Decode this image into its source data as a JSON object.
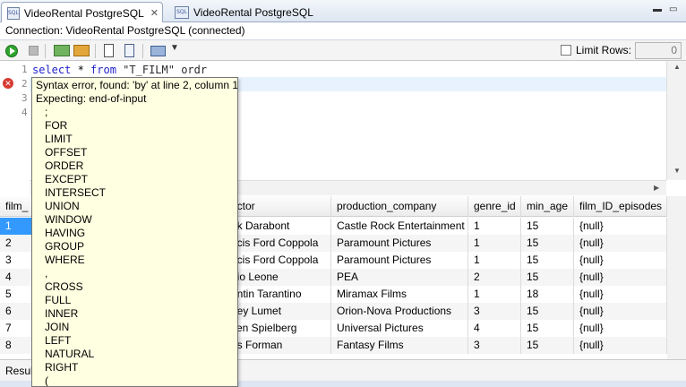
{
  "tabs": [
    {
      "label": "VideoRental PostgreSQL",
      "icon": "sql-file-icon",
      "active": true,
      "close": "✕"
    },
    {
      "label": "VideoRental PostgreSQL",
      "icon": "sql-file-icon",
      "active": false
    }
  ],
  "connection": {
    "text": "Connection: VideoRental PostgreSQL (connected)"
  },
  "toolbar": {
    "limit_rows_label": "Limit Rows:",
    "limit_rows_value": "0",
    "limit_rows_checked": false
  },
  "editor": {
    "line_numbers": [
      "1",
      "2",
      "3",
      "4"
    ],
    "line1": {
      "kw1": "select",
      "rest1": " * ",
      "kw2": "from",
      "rest2": " \"T_FILM\" ordr"
    }
  },
  "error_popup": {
    "message": "Syntax error, found: 'by' at line 2, column 1",
    "expecting": "Expecting: end-of-input",
    "options": [
      ";",
      "FOR",
      "LIMIT",
      "OFFSET",
      "ORDER",
      "EXCEPT",
      "INTERSECT",
      "UNION",
      "WINDOW",
      "HAVING",
      "GROUP",
      "WHERE",
      ",",
      "CROSS",
      "FULL",
      "INNER",
      "JOIN",
      "LEFT",
      "NATURAL",
      "RIGHT",
      "("
    ]
  },
  "grid": {
    "columns": [
      "film_",
      "ector",
      "production_company",
      "genre_id",
      "min_age",
      "film_ID_episodes"
    ],
    "rows": [
      [
        "1",
        "nk Darabont",
        "Castle Rock Entertainment",
        "1",
        "15",
        "{null}"
      ],
      [
        "2",
        "ncis Ford Coppola",
        "Paramount Pictures",
        "1",
        "15",
        "{null}"
      ],
      [
        "3",
        "ncis Ford Coppola",
        "Paramount Pictures",
        "1",
        "15",
        "{null}"
      ],
      [
        "4",
        "gio Leone",
        "PEA",
        "2",
        "15",
        "{null}"
      ],
      [
        "5",
        "entin Tarantino",
        "Miramax Films",
        "1",
        "18",
        "{null}"
      ],
      [
        "6",
        "ney Lumet",
        "Orion-Nova Productions",
        "3",
        "15",
        "{null}"
      ],
      [
        "7",
        "ven Spielberg",
        "Universal Pictures",
        "4",
        "15",
        "{null}"
      ],
      [
        "8",
        "os Forman",
        "Fantasy Films",
        "3",
        "15",
        "{null}"
      ]
    ],
    "selected_row": 0
  },
  "status": {
    "text": "Resul"
  }
}
